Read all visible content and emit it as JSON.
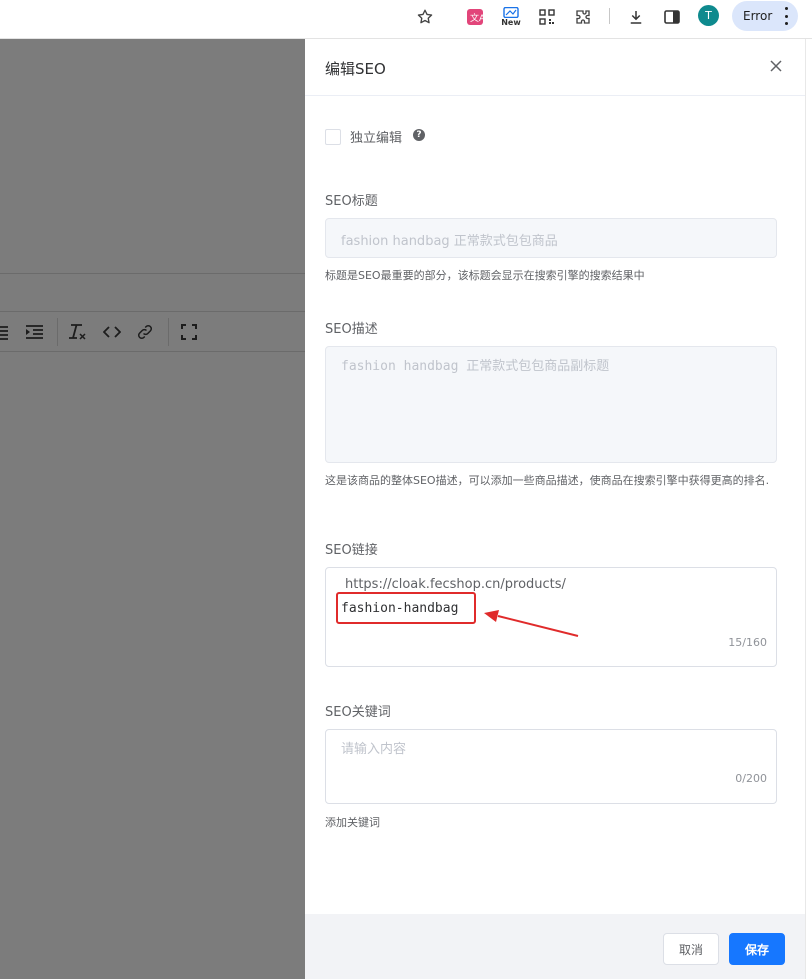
{
  "browser": {
    "new_badge": "New",
    "avatar_initial": "T",
    "error_chip": "Error"
  },
  "drawer": {
    "title": "编辑SEO",
    "standalone_edit": {
      "label": "独立编辑",
      "checked": false,
      "help_glyph": "?"
    },
    "seo_title": {
      "label": "SEO标题",
      "value": "fashion handbag 正常款式包包商品",
      "tip": "标题是SEO最重要的部分，该标题会显示在搜索引擎的搜索结果中"
    },
    "seo_description": {
      "label": "SEO描述",
      "value": "fashion handbag 正常款式包包商品副标题",
      "tip": "这是该商品的整体SEO描述，可以添加一些商品描述，使商品在搜索引擎中获得更高的排名."
    },
    "seo_link": {
      "label": "SEO链接",
      "prefix": "https://cloak.fecshop.cn/products/",
      "value": "fashion-handbag",
      "count": "15/160"
    },
    "seo_keywords": {
      "label": "SEO关键词",
      "placeholder": "请输入内容",
      "count": "0/200",
      "tip": "添加关键词"
    },
    "footer": {
      "cancel": "取消",
      "save": "保存"
    }
  },
  "colors": {
    "primary": "#1677ff",
    "annotation_red": "#e02b2b",
    "overlay": "#7c7c7c"
  },
  "icons": [
    "star-icon",
    "translate-icon",
    "new-badge-icon",
    "qr-code-icon",
    "extensions-icon",
    "download-icon",
    "side-panel-icon",
    "kebab-menu-icon",
    "close-icon",
    "help-icon",
    "align-justify-icon",
    "indent-icon",
    "clear-format-icon",
    "code-icon",
    "link-icon",
    "fullscreen-icon",
    "annotation-arrow"
  ]
}
